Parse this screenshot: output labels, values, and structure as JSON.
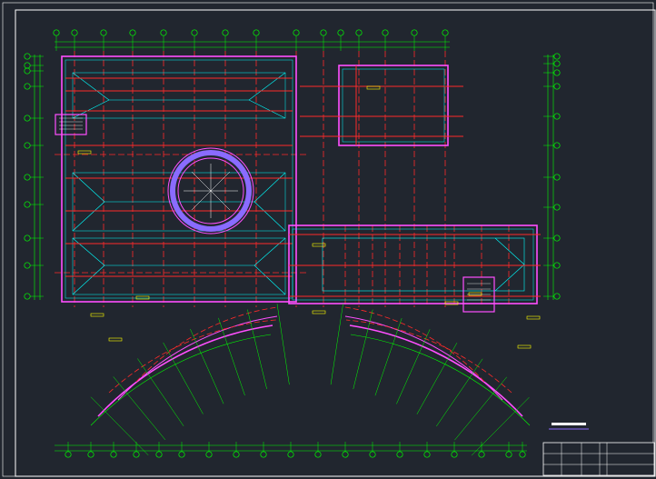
{
  "drawing": {
    "background": "#21262f",
    "colors": {
      "frame": "#ffffff",
      "axis": "#00ff00",
      "beam": "#ff2a2a",
      "wall": "#ff4fff",
      "column": "#00ffff",
      "ring": "#8a6bff",
      "label": "#ffff00",
      "dim": "#00ff00"
    }
  },
  "title_block": {
    "rows": [
      {
        "c1": "",
        "c2": "",
        "c3": "",
        "c4": "",
        "c5": "",
        "c6": ""
      },
      {
        "c1": "",
        "c2": "",
        "c3": "",
        "c4": "",
        "c5": "",
        "c6": ""
      },
      {
        "c1": "",
        "c2": "",
        "c3": "",
        "c4": "",
        "c5": "",
        "c6": ""
      }
    ]
  }
}
